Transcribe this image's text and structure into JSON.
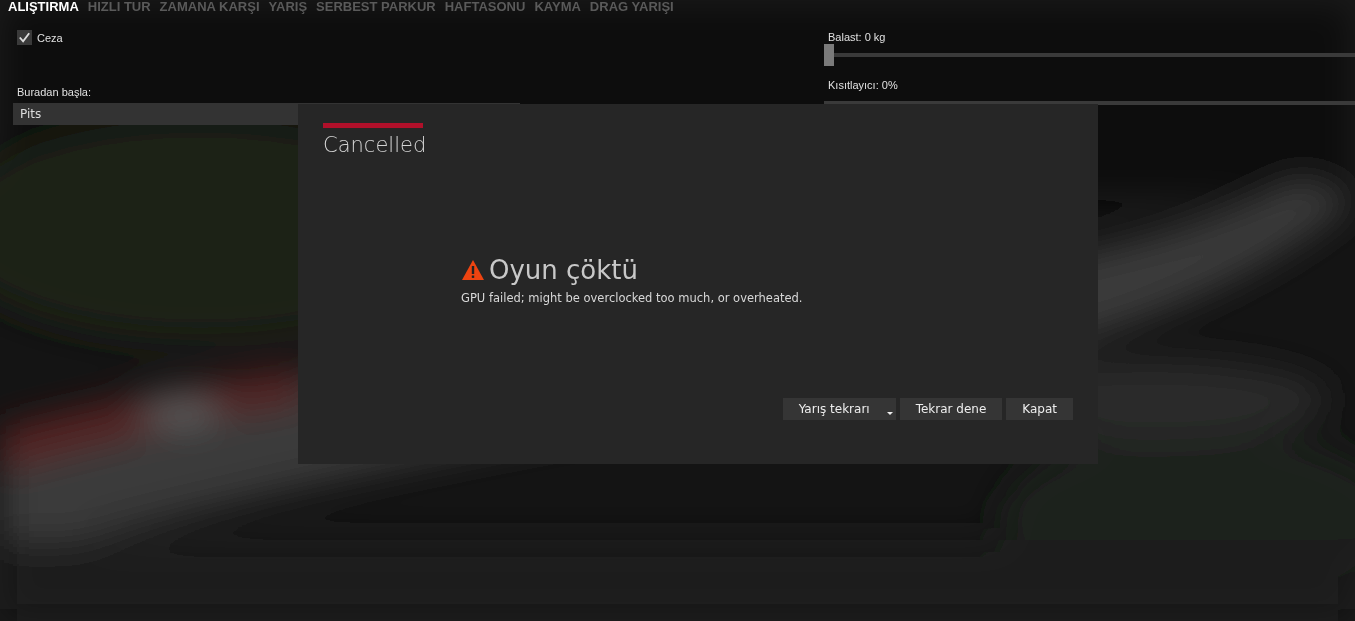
{
  "tabs": [
    {
      "label": "ALIŞTIRMA",
      "selected": true
    },
    {
      "label": "HIZLI TUR",
      "selected": false
    },
    {
      "label": "ZAMANA KARŞI",
      "selected": false
    },
    {
      "label": "YARIŞ",
      "selected": false
    },
    {
      "label": "SERBEST PARKUR",
      "selected": false
    },
    {
      "label": "HAFTASONU",
      "selected": false
    },
    {
      "label": "KAYMA",
      "selected": false
    },
    {
      "label": "DRAG YARIŞI",
      "selected": false
    }
  ],
  "left": {
    "penalty": {
      "label": "Ceza",
      "checked": true
    },
    "start_label": "Buradan başla:",
    "start_value": "Pits"
  },
  "right": {
    "sliders": [
      {
        "label": "Balast: 0 kg",
        "level": 0
      },
      {
        "label": "Kısıtlayıcı: 0%"
      }
    ]
  },
  "dialog": {
    "title": "Cancelled",
    "heading": "Oyun çöktü",
    "message": "GPU failed; might be overclocked too much, or overheated.",
    "buttons": [
      {
        "label": "Yarış tekrarı",
        "kind": "dropdown"
      },
      {
        "label": "Tekrar dene",
        "kind": "plain"
      },
      {
        "label": "Kapat",
        "kind": "plain"
      }
    ]
  }
}
